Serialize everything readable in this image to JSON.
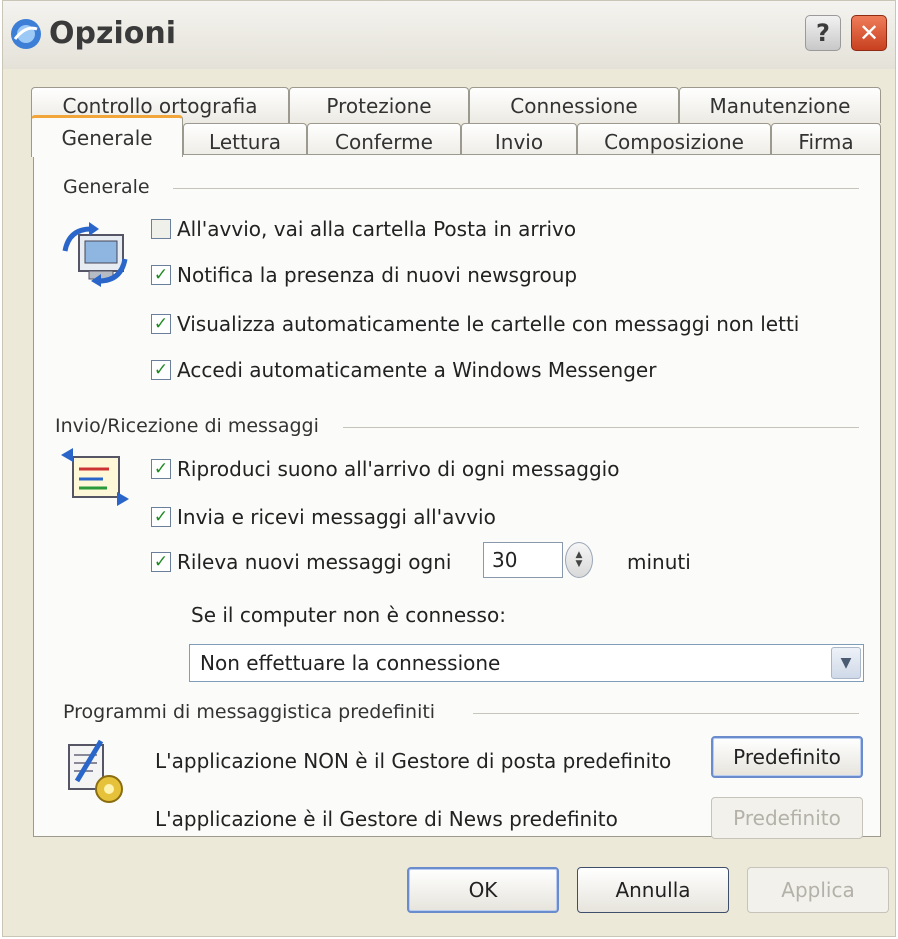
{
  "window": {
    "title": "Opzioni",
    "help_glyph": "?",
    "close_glyph": "✕"
  },
  "tabs": {
    "back_row": [
      "Controllo ortografia",
      "Protezione",
      "Connessione",
      "Manutenzione"
    ],
    "front_row": [
      "Generale",
      "Lettura",
      "Conferme",
      "Invio",
      "Composizione",
      "Firma"
    ],
    "active": "Generale"
  },
  "generale": {
    "heading": "Generale",
    "icon": "mail-sync-icon",
    "options": [
      {
        "label": "All'avvio, vai alla cartella Posta in arrivo",
        "checked": false
      },
      {
        "label": "Notifica la presenza di nuovi newsgroup",
        "checked": true
      },
      {
        "label": "Visualizza automaticamente le cartelle con messaggi non letti",
        "checked": true
      },
      {
        "label": "Accedi automaticamente a Windows Messenger",
        "checked": true
      }
    ]
  },
  "invio_ricezione": {
    "heading": "Invio/Ricezione di messaggi",
    "icon": "send-receive-icon",
    "options": [
      {
        "label": "Riproduci suono all'arrivo di ogni messaggio",
        "checked": true
      },
      {
        "label": "Invia e ricevi messaggi all'avvio",
        "checked": true
      },
      {
        "label": "Rileva nuovi messaggi ogni",
        "checked": true
      }
    ],
    "interval_value": "30",
    "interval_unit": "minuti",
    "not_connected_label": "Se il computer non è connesso:",
    "not_connected_selected": "Non effettuare la connessione"
  },
  "predefiniti": {
    "heading": "Programmi di messaggistica predefiniti",
    "icon": "default-programs-icon",
    "mail_text": "L'applicazione NON è il Gestore di posta predefinito",
    "mail_button": "Predefinito",
    "news_text": "L'applicazione è il Gestore di News predefinito",
    "news_button": "Predefinito"
  },
  "footer": {
    "ok": "OK",
    "cancel": "Annulla",
    "apply": "Applica"
  },
  "colors": {
    "tab_highlight": "#f2a63a",
    "check": "#1f8a22",
    "close_button": "#d9532c"
  }
}
